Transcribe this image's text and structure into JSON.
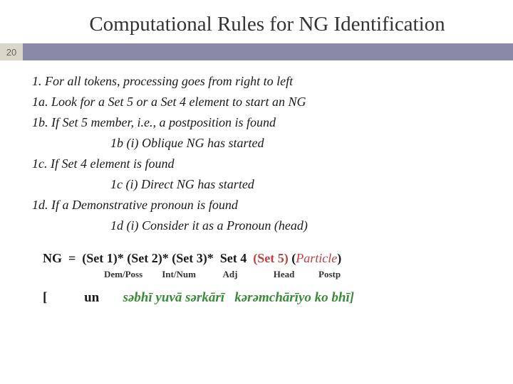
{
  "title": "Computational Rules for NG Identification",
  "page_number": "20",
  "rules": {
    "r1": "1.  For all tokens, processing goes from right to left",
    "r1a": "1a. Look for a Set 5 or a Set 4 element to start an NG",
    "r1b": "1b. If Set 5 member, i.e., a postposition is found",
    "r1b_i": "1b (i) Oblique NG has started",
    "r1c": "1c. If Set 4 element is found",
    "r1c_i": "1c (i) Direct NG has started",
    "r1d": "1d. If a Demonstrative pronoun is found",
    "r1d_i": "1d (i) Consider it as a Pronoun (head)"
  },
  "formula": {
    "ng": "NG",
    "eq": "=",
    "set1": "(Set 1)*",
    "set2": "(Set 2)*",
    "set3": "(Set 3)*",
    "set4": "Set 4",
    "set5": "(Set 5)",
    "lparen": "(",
    "particle": "Particle",
    "rparen": ")"
  },
  "labels": {
    "l1": "Dem/Poss",
    "l2": "Int/Num",
    "l3": "Adj",
    "l4": "Head",
    "l5": "Postp"
  },
  "example": {
    "lbr": "[",
    "un": "un",
    "sabhi": "səbhī",
    "yuva": "yuvā",
    "sarkari": "sərkārī",
    "tail": "kərəmchārīyo ko bhī]"
  }
}
